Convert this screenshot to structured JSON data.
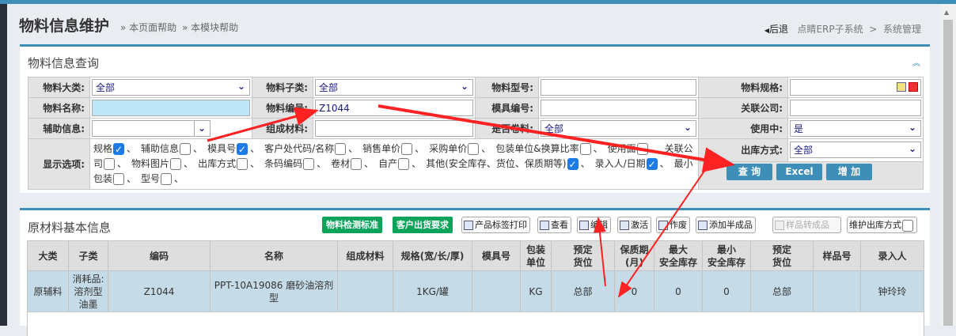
{
  "header": {
    "title": "物料信息维护",
    "help_page": "» 本页面帮助",
    "help_module": "» 本模块帮助",
    "back": "后退",
    "crumb1": "点睛ERP子系统",
    "crumb_sep": ">",
    "crumb2": "系统管理"
  },
  "query": {
    "title": "物料信息查询",
    "fields": {
      "category_label": "物料大类:",
      "category_value": "全部",
      "subcategory_label": "物料子类:",
      "subcategory_value": "全部",
      "model_label": "物料型号:",
      "spec_label": "物料规格:",
      "name_label": "物料名称:",
      "code_label": "物料编号:",
      "code_value": "Z1044",
      "mold_label": "模具编号:",
      "company_label": "关联公司:",
      "aux_label": "辅助信息:",
      "material_label": "组成材料:",
      "roll_label": "是否卷料:",
      "roll_value": "全部",
      "inuse_label": "使用中:",
      "inuse_value": "是",
      "options_label": "显示选项:",
      "outbound_label": "出库方式:",
      "outbound_value": "全部"
    },
    "options": [
      {
        "label": "规格",
        "checked": true
      },
      {
        "label": "辅助信息",
        "checked": false
      },
      {
        "label": "模具号",
        "checked": true
      },
      {
        "label": "客户处代码/名称",
        "checked": false
      },
      {
        "label": "销售单价",
        "checked": false
      },
      {
        "label": "采购单价",
        "checked": false
      },
      {
        "label": "包装单位&换算比率",
        "checked": false
      },
      {
        "label": "使用面",
        "checked": false
      },
      {
        "label": "关联公司",
        "checked": false
      },
      {
        "label": "物料图片",
        "checked": false
      },
      {
        "label": "出库方式",
        "checked": false
      },
      {
        "label": "条码编码",
        "checked": false
      },
      {
        "label": "卷材",
        "checked": false
      },
      {
        "label": "自产",
        "checked": false
      },
      {
        "label": "其他(安全库存、货位、保质期等)",
        "checked": true
      },
      {
        "label": "录入人/日期",
        "checked": true
      },
      {
        "label": "最小包装",
        "checked": false
      },
      {
        "label": "型号",
        "checked": false
      }
    ],
    "sep": "、",
    "buttons": {
      "query": "查 询",
      "excel": "Excel",
      "add": "增 加"
    }
  },
  "results": {
    "title": "原材料基本信息",
    "toolbar": {
      "inspect": "物料检测标准",
      "shipment": "客户出货要求",
      "print": "产品标签打印",
      "view": "查看",
      "edit": "编辑",
      "activate": "激活",
      "void": "作废",
      "add_semi": "添加半成品",
      "sample_to_product": "样品转成品",
      "maintain_outbound": "维护出库方式"
    },
    "columns": [
      "大类",
      "子类",
      "编码",
      "名称",
      "组成材料",
      "规格(宽/长/厚)",
      "模具号",
      "包装\n单位",
      "预定\n货位",
      "保质期\n(月)",
      "最大\n安全库存",
      "最小\n安全库存",
      "预定\n货位",
      "样品号",
      "录入人"
    ],
    "rows": [
      [
        "原辅料",
        "消耗品:\n溶剂型\n油墨",
        "Z1044",
        "PPT-10A19086 磨砂油溶剂型",
        "",
        "1KG/罐",
        "",
        "KG",
        "总部",
        "0",
        "0",
        "0",
        "总部",
        "",
        "钟玲玲"
      ]
    ]
  },
  "colors": {
    "accent": "#3d8fb8",
    "green": "#0aa35a",
    "check": "#1e7be6",
    "row": "#c5dbe7"
  }
}
